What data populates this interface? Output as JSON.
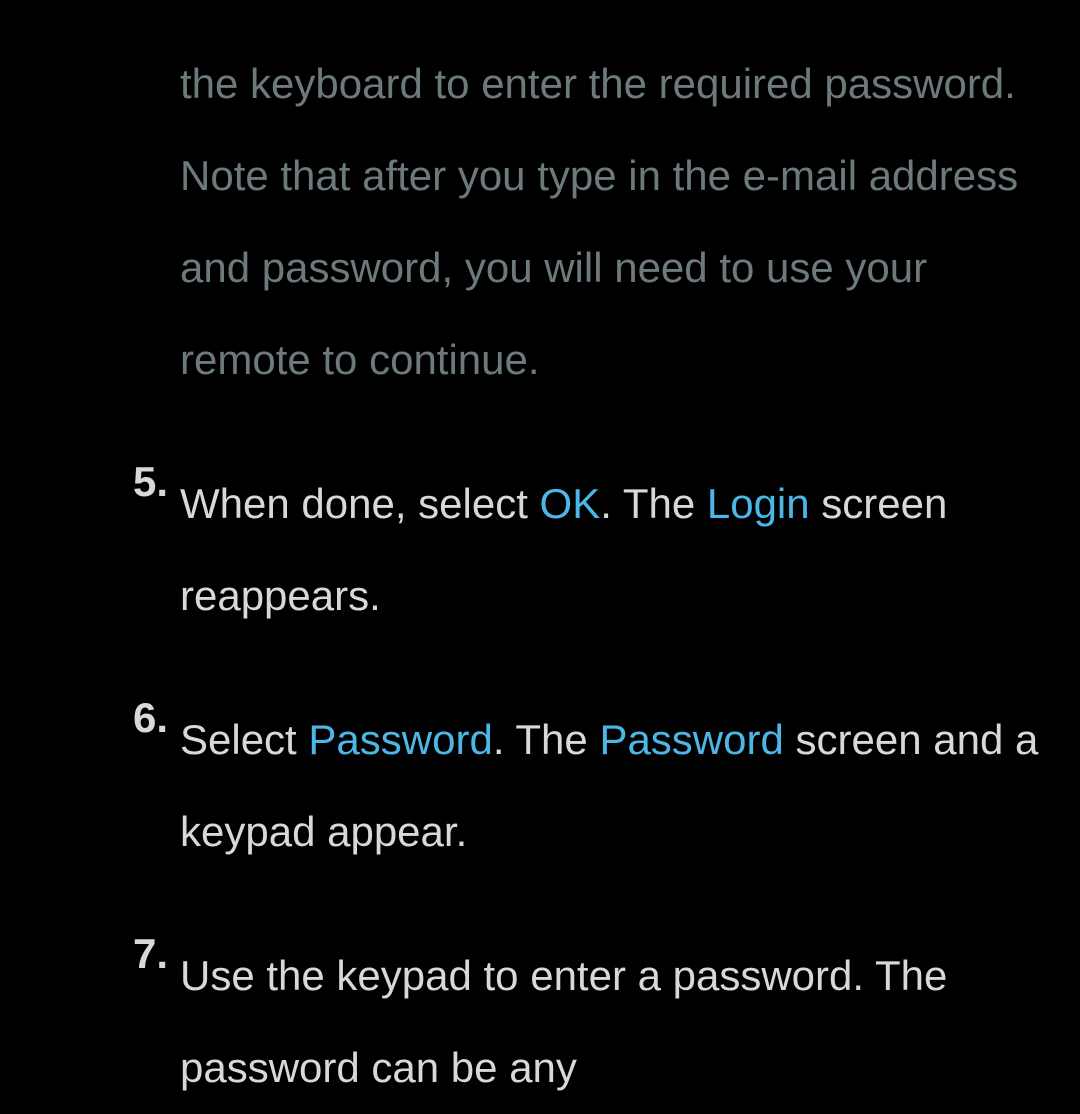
{
  "continuation_text": "the keyboard to enter the required password. Note that after you type in the e-mail address and password, you will need to use your remote to continue.",
  "items": [
    {
      "number": "5.",
      "segments": [
        {
          "text": "When done, select ",
          "highlight": false
        },
        {
          "text": "OK",
          "highlight": true
        },
        {
          "text": ". The ",
          "highlight": false
        },
        {
          "text": "Login",
          "highlight": true
        },
        {
          "text": " screen reappears.",
          "highlight": false
        }
      ]
    },
    {
      "number": "6.",
      "segments": [
        {
          "text": "Select ",
          "highlight": false
        },
        {
          "text": "Password",
          "highlight": true
        },
        {
          "text": ". The ",
          "highlight": false
        },
        {
          "text": "Password",
          "highlight": true
        },
        {
          "text": " screen and a keypad appear.",
          "highlight": false
        }
      ]
    },
    {
      "number": "7.",
      "segments": [
        {
          "text": "Use the keypad to enter a password. The password can be any",
          "highlight": false
        }
      ]
    }
  ]
}
